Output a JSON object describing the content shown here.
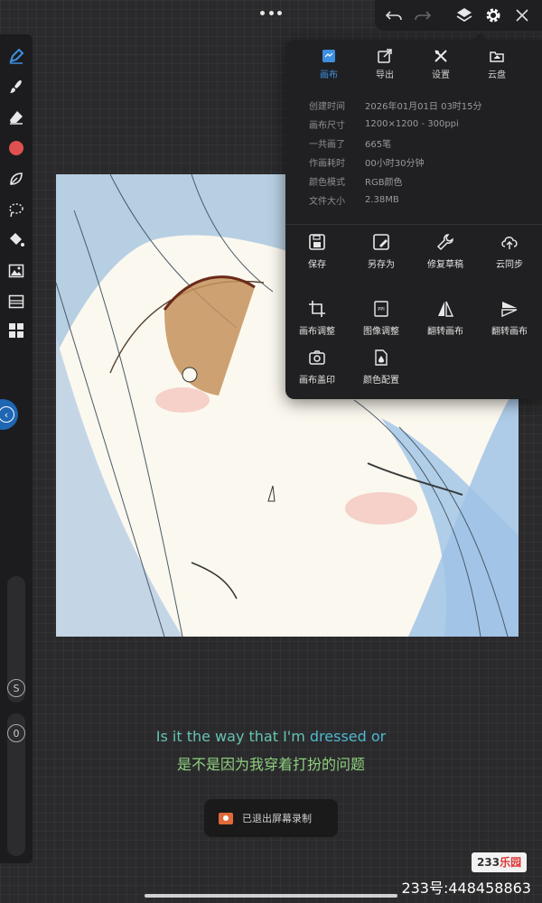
{
  "panel": {
    "tabs": [
      {
        "label": "画布",
        "icon": "canvas-icon",
        "active": true
      },
      {
        "label": "导出",
        "icon": "export-icon",
        "active": false
      },
      {
        "label": "设置",
        "icon": "settings-tools-icon",
        "active": false
      },
      {
        "label": "云盘",
        "icon": "cloud-folder-icon",
        "active": false
      }
    ],
    "info": [
      {
        "key": "创建时间",
        "value": "2026年01月01日 03时15分"
      },
      {
        "key": "画布尺寸",
        "value": "1200×1200 - 300ppi"
      },
      {
        "key": "一共画了",
        "value": "665笔"
      },
      {
        "key": "作画耗时",
        "value": "00小时30分钟"
      },
      {
        "key": "颜色模式",
        "value": "RGB颜色"
      },
      {
        "key": "文件大小",
        "value": "2.38MB"
      }
    ],
    "actions": [
      {
        "label": "保存",
        "icon": "save-icon"
      },
      {
        "label": "另存为",
        "icon": "save-as-icon"
      },
      {
        "label": "修复草稿",
        "icon": "wrench-icon"
      },
      {
        "label": "云同步",
        "icon": "cloud-sync-icon"
      },
      {
        "label": "画布调整",
        "icon": "crop-icon"
      },
      {
        "label": "图像调整",
        "icon": "ppi-icon"
      },
      {
        "label": "翻转画布",
        "icon": "flip-horizontal-icon"
      },
      {
        "label": "翻转画布",
        "icon": "flip-vertical-icon"
      },
      {
        "label": "画布盖印",
        "icon": "camera-stamp-icon"
      },
      {
        "label": "颜色配置",
        "icon": "color-profile-icon"
      }
    ]
  },
  "sidebar": {
    "brush_size_label": "S",
    "opacity_label": "0",
    "active_color": "#e05050",
    "toggle_icon": "collapse-left-icon"
  },
  "subtitles": {
    "en_part1": "Is it the way that I'm ",
    "en_part2": "dressed or",
    "zh": "是不是因为我穿着打扮的问题"
  },
  "toast": {
    "text": "已退出屏幕录制",
    "icon": "screen-record-icon"
  },
  "watermark": {
    "logo_number": "233",
    "logo_text": "乐园",
    "id_text": "233号:448458863"
  },
  "colors": {
    "accent": "#3d8fe0",
    "panel_bg": "#202022",
    "toggle_blue": "#1f66b3"
  }
}
